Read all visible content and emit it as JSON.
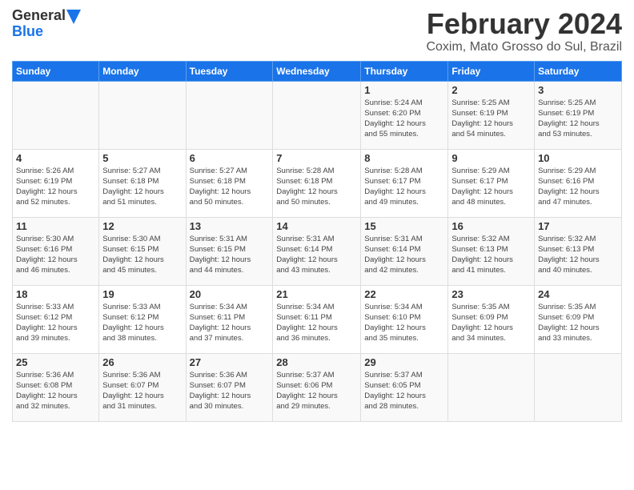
{
  "header": {
    "logo_general": "General",
    "logo_blue": "Blue",
    "month_title": "February 2024",
    "subtitle": "Coxim, Mato Grosso do Sul, Brazil"
  },
  "weekdays": [
    "Sunday",
    "Monday",
    "Tuesday",
    "Wednesday",
    "Thursday",
    "Friday",
    "Saturday"
  ],
  "weeks": [
    [
      {
        "day": "",
        "info": ""
      },
      {
        "day": "",
        "info": ""
      },
      {
        "day": "",
        "info": ""
      },
      {
        "day": "",
        "info": ""
      },
      {
        "day": "1",
        "info": "Sunrise: 5:24 AM\nSunset: 6:20 PM\nDaylight: 12 hours\nand 55 minutes."
      },
      {
        "day": "2",
        "info": "Sunrise: 5:25 AM\nSunset: 6:19 PM\nDaylight: 12 hours\nand 54 minutes."
      },
      {
        "day": "3",
        "info": "Sunrise: 5:25 AM\nSunset: 6:19 PM\nDaylight: 12 hours\nand 53 minutes."
      }
    ],
    [
      {
        "day": "4",
        "info": "Sunrise: 5:26 AM\nSunset: 6:19 PM\nDaylight: 12 hours\nand 52 minutes."
      },
      {
        "day": "5",
        "info": "Sunrise: 5:27 AM\nSunset: 6:18 PM\nDaylight: 12 hours\nand 51 minutes."
      },
      {
        "day": "6",
        "info": "Sunrise: 5:27 AM\nSunset: 6:18 PM\nDaylight: 12 hours\nand 50 minutes."
      },
      {
        "day": "7",
        "info": "Sunrise: 5:28 AM\nSunset: 6:18 PM\nDaylight: 12 hours\nand 50 minutes."
      },
      {
        "day": "8",
        "info": "Sunrise: 5:28 AM\nSunset: 6:17 PM\nDaylight: 12 hours\nand 49 minutes."
      },
      {
        "day": "9",
        "info": "Sunrise: 5:29 AM\nSunset: 6:17 PM\nDaylight: 12 hours\nand 48 minutes."
      },
      {
        "day": "10",
        "info": "Sunrise: 5:29 AM\nSunset: 6:16 PM\nDaylight: 12 hours\nand 47 minutes."
      }
    ],
    [
      {
        "day": "11",
        "info": "Sunrise: 5:30 AM\nSunset: 6:16 PM\nDaylight: 12 hours\nand 46 minutes."
      },
      {
        "day": "12",
        "info": "Sunrise: 5:30 AM\nSunset: 6:15 PM\nDaylight: 12 hours\nand 45 minutes."
      },
      {
        "day": "13",
        "info": "Sunrise: 5:31 AM\nSunset: 6:15 PM\nDaylight: 12 hours\nand 44 minutes."
      },
      {
        "day": "14",
        "info": "Sunrise: 5:31 AM\nSunset: 6:14 PM\nDaylight: 12 hours\nand 43 minutes."
      },
      {
        "day": "15",
        "info": "Sunrise: 5:31 AM\nSunset: 6:14 PM\nDaylight: 12 hours\nand 42 minutes."
      },
      {
        "day": "16",
        "info": "Sunrise: 5:32 AM\nSunset: 6:13 PM\nDaylight: 12 hours\nand 41 minutes."
      },
      {
        "day": "17",
        "info": "Sunrise: 5:32 AM\nSunset: 6:13 PM\nDaylight: 12 hours\nand 40 minutes."
      }
    ],
    [
      {
        "day": "18",
        "info": "Sunrise: 5:33 AM\nSunset: 6:12 PM\nDaylight: 12 hours\nand 39 minutes."
      },
      {
        "day": "19",
        "info": "Sunrise: 5:33 AM\nSunset: 6:12 PM\nDaylight: 12 hours\nand 38 minutes."
      },
      {
        "day": "20",
        "info": "Sunrise: 5:34 AM\nSunset: 6:11 PM\nDaylight: 12 hours\nand 37 minutes."
      },
      {
        "day": "21",
        "info": "Sunrise: 5:34 AM\nSunset: 6:11 PM\nDaylight: 12 hours\nand 36 minutes."
      },
      {
        "day": "22",
        "info": "Sunrise: 5:34 AM\nSunset: 6:10 PM\nDaylight: 12 hours\nand 35 minutes."
      },
      {
        "day": "23",
        "info": "Sunrise: 5:35 AM\nSunset: 6:09 PM\nDaylight: 12 hours\nand 34 minutes."
      },
      {
        "day": "24",
        "info": "Sunrise: 5:35 AM\nSunset: 6:09 PM\nDaylight: 12 hours\nand 33 minutes."
      }
    ],
    [
      {
        "day": "25",
        "info": "Sunrise: 5:36 AM\nSunset: 6:08 PM\nDaylight: 12 hours\nand 32 minutes."
      },
      {
        "day": "26",
        "info": "Sunrise: 5:36 AM\nSunset: 6:07 PM\nDaylight: 12 hours\nand 31 minutes."
      },
      {
        "day": "27",
        "info": "Sunrise: 5:36 AM\nSunset: 6:07 PM\nDaylight: 12 hours\nand 30 minutes."
      },
      {
        "day": "28",
        "info": "Sunrise: 5:37 AM\nSunset: 6:06 PM\nDaylight: 12 hours\nand 29 minutes."
      },
      {
        "day": "29",
        "info": "Sunrise: 5:37 AM\nSunset: 6:05 PM\nDaylight: 12 hours\nand 28 minutes."
      },
      {
        "day": "",
        "info": ""
      },
      {
        "day": "",
        "info": ""
      }
    ]
  ]
}
